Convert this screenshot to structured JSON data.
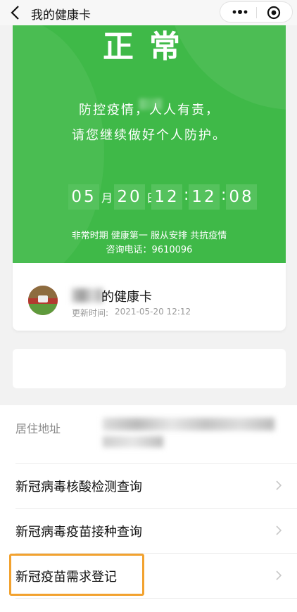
{
  "nav": {
    "title": "我的健康卡",
    "back_icon": "chevron-left-icon",
    "more_icon": "more-dots-icon",
    "close_icon": "target-close-icon"
  },
  "status_card": {
    "status": "正常",
    "message_line1": "防控疫情，人人有责，",
    "message_line2": "请您继续做好个人防护。",
    "clock": {
      "month": "05",
      "month_unit": "月",
      "day": "20",
      "day_unit": "日",
      "hour": "12",
      "minute": "12",
      "second": "08"
    },
    "slogan": "非常时期 健康第一 服从安排 共抗疫情",
    "hotline": "咨询电话：9610096",
    "color": "#3fb948"
  },
  "user_card": {
    "card_name": "的健康卡",
    "update_label": "更新时间:",
    "update_time": "2021-05-20 12:12"
  },
  "list": {
    "address_label": "居住地址",
    "items": [
      {
        "label": "新冠病毒核酸检测查询"
      },
      {
        "label": "新冠病毒疫苗接种查询"
      },
      {
        "label": "新冠疫苗需求登记"
      }
    ],
    "highlight_color": "#f2a22f"
  }
}
